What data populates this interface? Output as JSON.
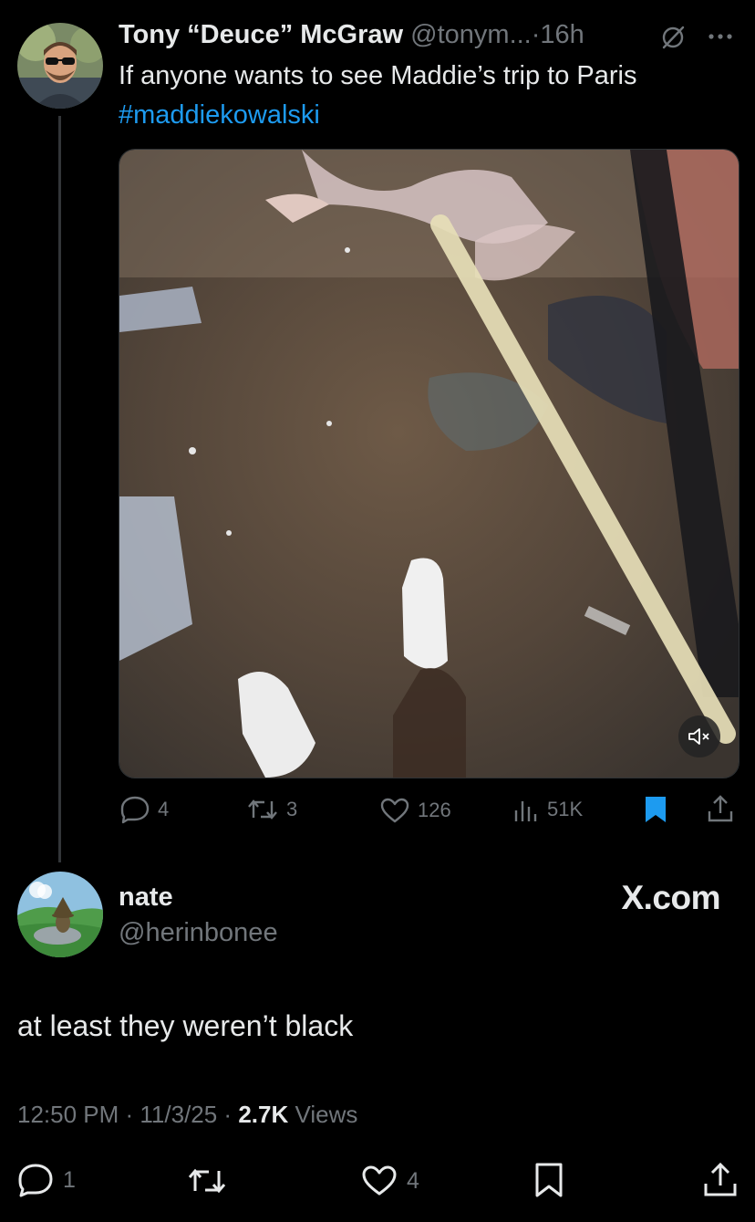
{
  "original_tweet": {
    "author_name": "Tony “Deuce” McGraw",
    "handle": "@tonym...",
    "separator": "·",
    "time": "16h",
    "text": "If anyone wants to see Maddie’s trip to Paris",
    "hashtag": "#maddiekowalski",
    "media": {
      "type": "video",
      "muted": true,
      "icon": "speaker-muted-icon"
    },
    "actions": {
      "replies": "4",
      "reposts": "3",
      "likes": "126",
      "views": "51K"
    }
  },
  "reply": {
    "author_name": "nate",
    "handle": "@herinbonee",
    "watermark": "X.com",
    "text": "at least they weren’t black",
    "timestamp": "12:50 PM · 11/3/25 · ",
    "views_count": "2.7K",
    "views_label": " Views",
    "actions": {
      "replies": "1",
      "likes": "4"
    }
  },
  "colors": {
    "background": "#000000",
    "text": "#e7e9ea",
    "muted": "#71767b",
    "link": "#1d9bf0",
    "bookmark_active": "#1d9bf0"
  }
}
